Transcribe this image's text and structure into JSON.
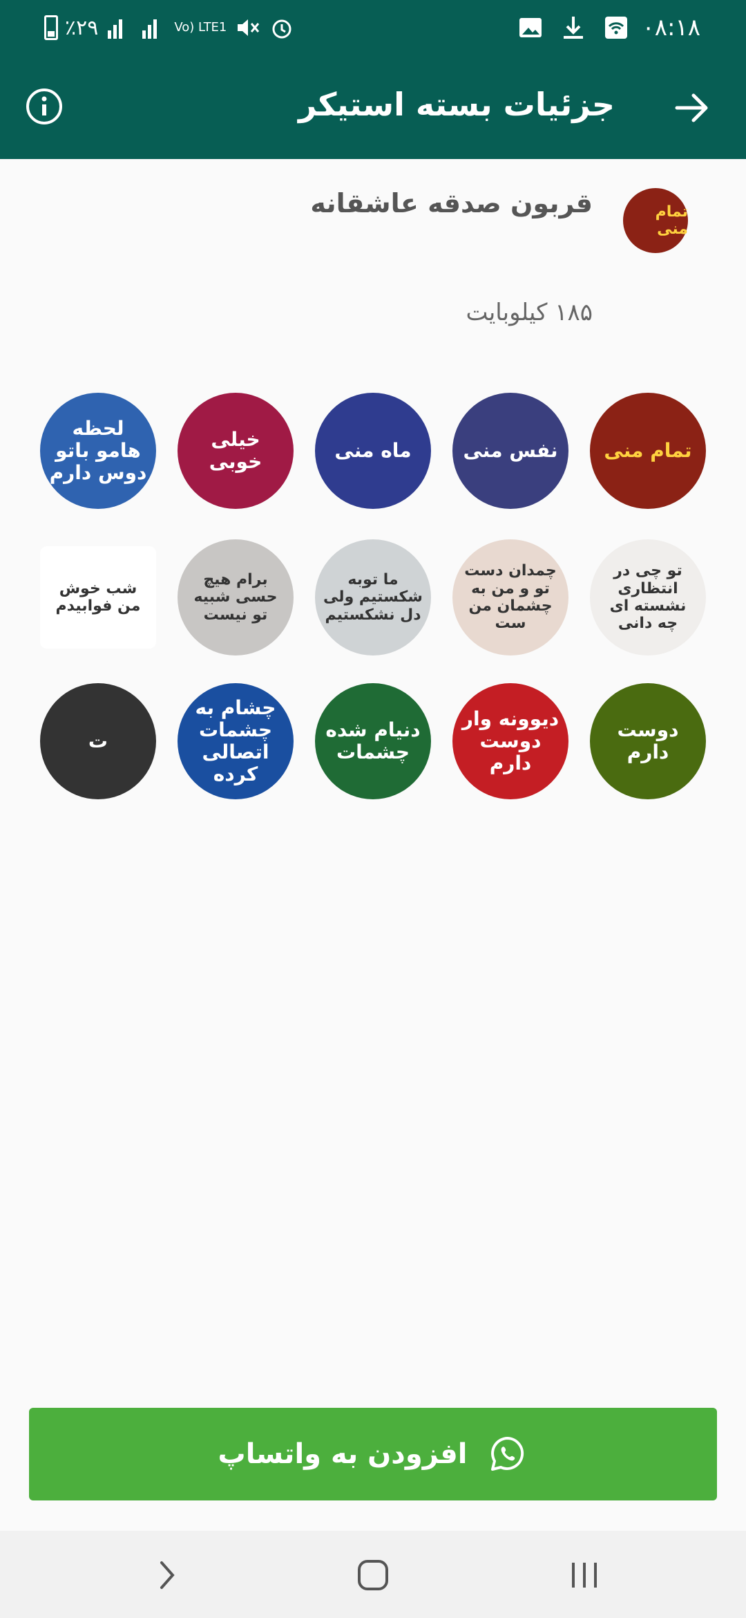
{
  "status_bar": {
    "time": "۰۸:۱۸",
    "battery": "٪۲۹",
    "network": "Vo) LTE1"
  },
  "toolbar": {
    "title": "جزئیات بسته استیکر",
    "back_icon": "arrow-right-icon",
    "info_icon": "info-icon"
  },
  "pack": {
    "name": "قربون صدقه عاشقانه",
    "size": "۱۸۵ کیلوبایت",
    "icon_text": "تمام منی"
  },
  "stickers": [
    {
      "text": "تمام منی",
      "bg": "#8b2215",
      "style": "yellow"
    },
    {
      "text": "نفس منی",
      "bg": "#3a3f7e",
      "style": "white"
    },
    {
      "text": "ماه منی",
      "bg": "#2f3c8f",
      "style": "white"
    },
    {
      "text": "خیلی خوبی",
      "bg": "#a01a45",
      "style": "white"
    },
    {
      "text": "لحظه هامو باتو دوس دارم",
      "bg": "#2f63b0",
      "style": "white"
    },
    {
      "text": "تو چی در انتظاری نشسته ای چه دانی",
      "bg": "#f0eeec",
      "style": "dark"
    },
    {
      "text": "چمدان دست تو و من به چشمان من ست",
      "bg": "#e8d9d0",
      "style": "dark"
    },
    {
      "text": "ما توبه شکستیم ولی دل نشکستیم",
      "bg": "#cfd3d5",
      "style": "dark"
    },
    {
      "text": "برام هیچ حسی شبیه تو نیست",
      "bg": "#c8c6c4",
      "style": "dark"
    },
    {
      "text": "شب خوش من فوابیدم",
      "bg": "#ffffff",
      "style": "dark"
    },
    {
      "text": "دوست دارم",
      "bg": "#4a6b10",
      "style": "white"
    },
    {
      "text": "دیوونه وار دوست دارم",
      "bg": "#c41e24",
      "style": "white"
    },
    {
      "text": "دنیام شده چشمات",
      "bg": "#1f6b35",
      "style": "white"
    },
    {
      "text": "چشام به چشمات اتصالی کرده",
      "bg": "#1a4fa0",
      "style": "white"
    },
    {
      "text": "ت",
      "bg": "#333333",
      "style": "white"
    }
  ],
  "add_button": {
    "label": "افزودن به واتساپ",
    "icon": "whatsapp-icon",
    "color": "#4caf3d"
  },
  "colors": {
    "header": "#075e54",
    "accent": "#4caf3d"
  }
}
